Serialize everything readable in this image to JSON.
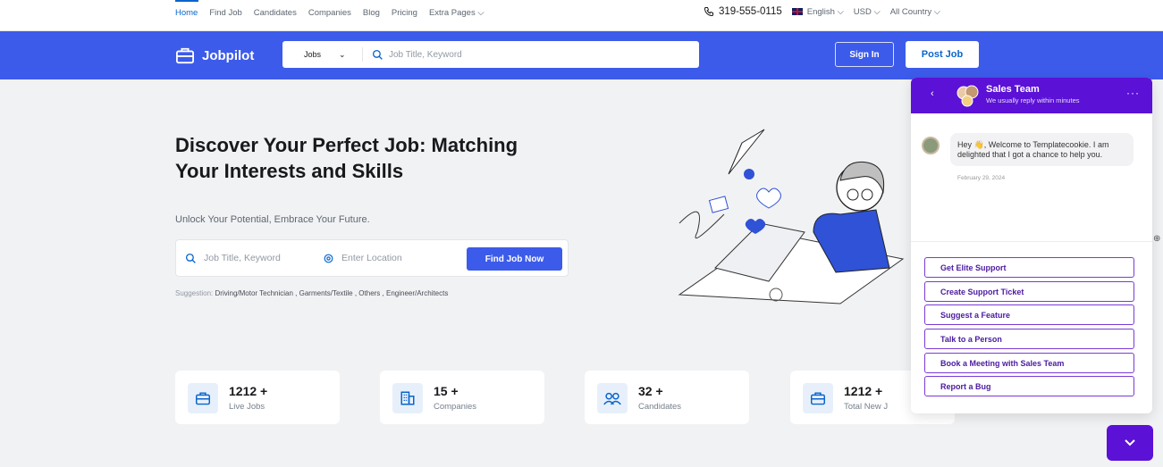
{
  "topbar": {
    "nav": [
      "Home",
      "Find Job",
      "Candidates",
      "Companies",
      "Blog",
      "Pricing",
      "Extra Pages"
    ],
    "phone": "319-555-0115",
    "language": "English",
    "currency": "USD",
    "country": "All Country"
  },
  "header": {
    "brand": "Jobpilot",
    "search_category": "Jobs",
    "search_placeholder": "Job Title, Keyword",
    "sign_in": "Sign In",
    "post_job": "Post Job",
    "accent": "#3c5bea"
  },
  "hero": {
    "title": "Discover Your Perfect Job: Matching Your Interests and Skills",
    "subtitle": "Unlock Your Potential, Embrace Your Future.",
    "job_placeholder": "Job Title, Keyword",
    "location_placeholder": "Enter Location",
    "find_button": "Find Job Now",
    "suggestion_label": "Suggestion:",
    "suggestions": "Driving/Motor Technician , Garments/Textile , Others , Engineer/Architects"
  },
  "stats": [
    {
      "value": "1212 +",
      "label": "Live Jobs",
      "icon": "briefcase-icon"
    },
    {
      "value": "15 +",
      "label": "Companies",
      "icon": "building-icon"
    },
    {
      "value": "32 +",
      "label": "Candidates",
      "icon": "users-icon"
    },
    {
      "value": "1212 +",
      "label": "Total New J",
      "icon": "briefcase-icon"
    }
  ],
  "chat": {
    "title": "Sales Team",
    "status": "We usually reply within minutes",
    "message": "Hey 👋, Welcome to Templatecookie. I am delighted that I got a chance to help you.",
    "date": "February 29, 2024",
    "options": [
      "Get Elite Support",
      "Create Support Ticket",
      "Suggest a Feature",
      "Talk to a Person",
      "Book a Meeting with Sales Team",
      "Report a Bug"
    ],
    "accent": "#5b11d6"
  }
}
